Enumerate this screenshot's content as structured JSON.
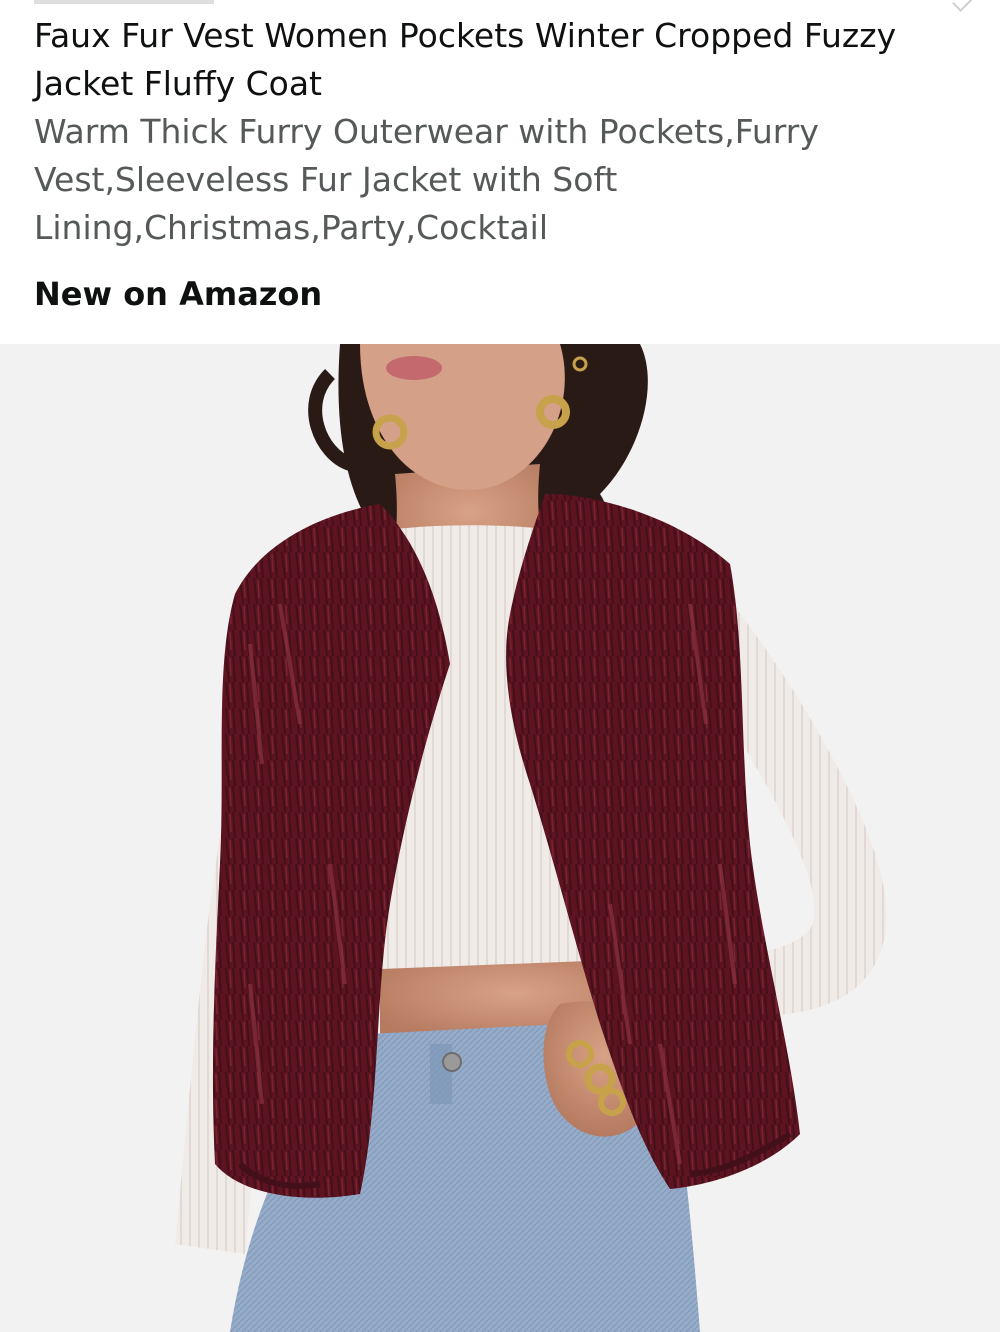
{
  "product": {
    "title": "Faux Fur Vest Women Pockets Winter Cropped Fuzzy Jacket Fluffy Coat",
    "subtitle": "Warm Thick Furry Outerwear with Pockets,Furry Vest,Sleeveless Fur Jacket with Soft Lining,Christmas,Party,Cocktail",
    "badge": "New on Amazon"
  },
  "image": {
    "subject": "product-photo",
    "colors": {
      "background": "#f3f2f2",
      "vest": "#5e1420",
      "top": "#f1ebe8",
      "jeans": "#8fa6c4",
      "skin": "#c98f74",
      "hair": "#2a1a16"
    }
  }
}
